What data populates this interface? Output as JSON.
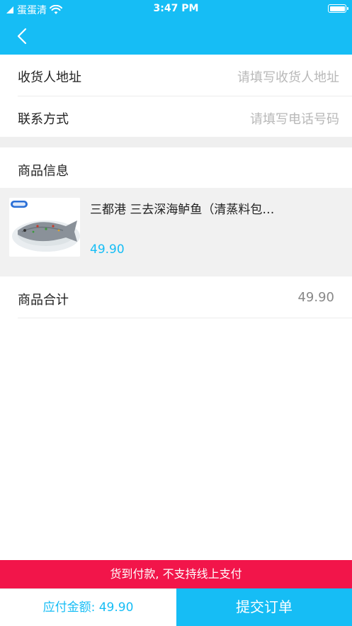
{
  "status_bar": {
    "carrier": "蛋蛋清",
    "time": "3:47 PM"
  },
  "icons": {
    "back": "chevron-left-icon",
    "wifi": "wifi-icon",
    "battery": "battery-icon",
    "signal": "signal-icon"
  },
  "address": {
    "label": "收货人地址",
    "placeholder": "请填写收货人地址"
  },
  "contact": {
    "label": "联系方式",
    "placeholder": "请填写电话号码"
  },
  "product_section": {
    "title": "商品信息",
    "product_name": "三都港 三去深海鲈鱼（清蒸料包…",
    "product_price": "49.90"
  },
  "total": {
    "label": "商品合计",
    "value": "49.90"
  },
  "cod_notice": "货到付款, 不支持线上支付",
  "footer": {
    "pay_amount": "应付金额: 49.90",
    "submit_label": "提交订单"
  },
  "colors": {
    "primary": "#16bdf5",
    "notice": "#f2154a",
    "band": "#efefef"
  }
}
